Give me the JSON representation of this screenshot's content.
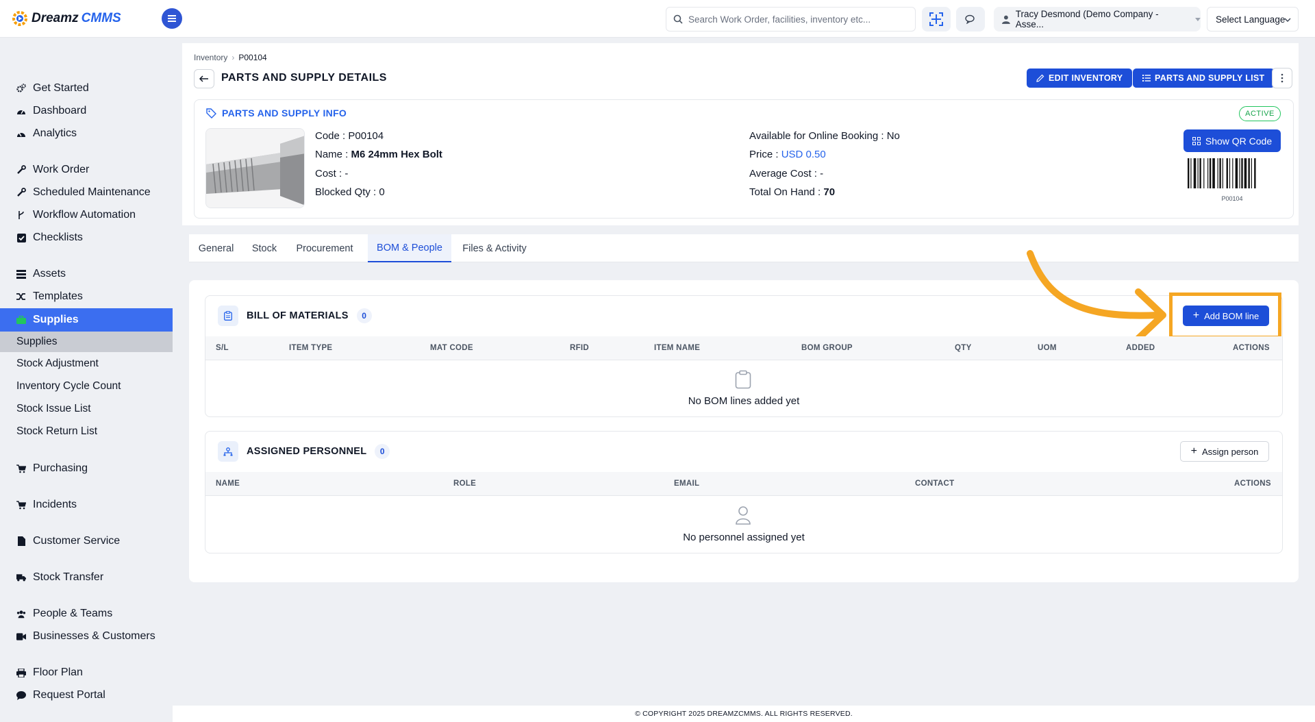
{
  "app": {
    "logo_part1": "Dreamz",
    "logo_part2": "CMMS"
  },
  "topbar": {
    "search_placeholder": "Search Work Order, facilities, inventory etc...",
    "user_label": "Tracy Desmond (Demo Company - Asse...",
    "language_label": "Select Language"
  },
  "sidebar": {
    "items": [
      {
        "label": "Get Started",
        "icon": "cogs-icon"
      },
      {
        "label": "Dashboard",
        "icon": "dashboard-icon"
      },
      {
        "label": "Analytics",
        "icon": "analytics-icon"
      },
      {
        "label": "Work Order",
        "icon": "wrench-icon"
      },
      {
        "label": "Scheduled Maintenance",
        "icon": "wrench-icon"
      },
      {
        "label": "Workflow Automation",
        "icon": "branch-icon"
      },
      {
        "label": "Checklists",
        "icon": "checkbox-icon"
      },
      {
        "label": "Assets",
        "icon": "assets-icon"
      },
      {
        "label": "Templates",
        "icon": "shuffle-icon"
      },
      {
        "label": "Supplies",
        "icon": "briefcase-icon"
      },
      {
        "label": "Purchasing",
        "icon": "cart-icon"
      },
      {
        "label": "Incidents",
        "icon": "cart-icon"
      },
      {
        "label": "Customer Service",
        "icon": "file-icon"
      },
      {
        "label": "Stock Transfer",
        "icon": "truck-icon"
      },
      {
        "label": "People & Teams",
        "icon": "users-icon"
      },
      {
        "label": "Businesses & Customers",
        "icon": "video-icon"
      },
      {
        "label": "Floor Plan",
        "icon": "printer-icon"
      },
      {
        "label": "Request Portal",
        "icon": "comment-icon"
      }
    ],
    "supplies_sub": [
      "Supplies",
      "Stock Adjustment",
      "Inventory Cycle Count",
      "Stock Issue List",
      "Stock Return List"
    ]
  },
  "breadcrumb": {
    "root": "Inventory",
    "current": "P00104"
  },
  "header": {
    "title": "PARTS AND SUPPLY DETAILS",
    "edit_label": "EDIT INVENTORY",
    "list_label": "PARTS AND SUPPLY LIST"
  },
  "info": {
    "heading": "PARTS AND SUPPLY INFO",
    "status": "ACTIVE",
    "code_label": "Code :",
    "code_value": "P00104",
    "name_label": "Name :",
    "name_value": "M6 24mm Hex Bolt",
    "cost_label": "Cost :",
    "cost_value": "-",
    "blocked_label": "Blocked Qty :",
    "blocked_value": "0",
    "online_label": "Available for Online Booking :",
    "online_value": "No",
    "price_label": "Price :",
    "price_value": "USD 0.50",
    "avg_label": "Average Cost :",
    "avg_value": "-",
    "total_label": "Total On Hand :",
    "total_value": "70",
    "qr_label": "Show QR Code",
    "barcode_text": "P00104"
  },
  "tabs": [
    "General",
    "Stock",
    "Procurement",
    "BOM & People",
    "Files & Activity"
  ],
  "bom": {
    "title": "BILL OF MATERIALS",
    "count": "0",
    "add_label": "Add BOM line",
    "columns": [
      "S/L",
      "ITEM TYPE",
      "MAT CODE",
      "RFID",
      "ITEM NAME",
      "BOM GROUP",
      "QTY",
      "UOM",
      "ADDED",
      "ACTIONS"
    ],
    "empty": "No BOM lines added yet"
  },
  "personnel": {
    "title": "ASSIGNED PERSONNEL",
    "count": "0",
    "assign_label": "Assign person",
    "columns": [
      "NAME",
      "ROLE",
      "EMAIL",
      "CONTACT",
      "ACTIONS"
    ],
    "empty": "No personnel assigned yet"
  },
  "footer": "© COPYRIGHT 2025 DREAMZCMMS. ALL RIGHTS RESERVED.",
  "colors": {
    "primary": "#1d4ed8",
    "sidebar_active": "#3b6ef0",
    "highlight": "#f5a623",
    "active_badge": "#22c55e"
  }
}
